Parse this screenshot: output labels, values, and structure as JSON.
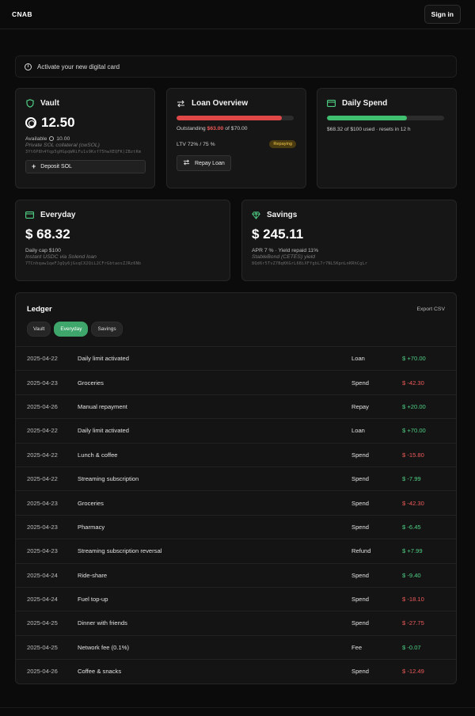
{
  "header": {
    "logo": "CNAB",
    "signin": "Sign in"
  },
  "banner": {
    "icon": "info-icon",
    "text": "Activate your new digital card"
  },
  "vault": {
    "title": "Vault",
    "icon": "shield-icon",
    "balance": "12.50",
    "available_label": "Available",
    "available_value": "10.00",
    "desc": "Private SOL collateral (cwSOL)",
    "address": "3Yt6P8h4Yqp5gHGpqWRiFu1s9Kxf75hwXEQFK)ZBztKm",
    "deposit_label": "Deposit SOL"
  },
  "loan": {
    "title": "Loan Overview",
    "icon": "swap-icon",
    "progress": 0.9,
    "outstanding_prefix": "Outstanding",
    "outstanding_amount": "$63.00",
    "outstanding_suffix": "of $70.00",
    "ltv": "LTV 72% / 75 %",
    "status": "Repaying",
    "repay_label": "Repay Loan"
  },
  "daily": {
    "title": "Daily Spend",
    "icon": "card-icon",
    "progress": 0.6832,
    "text": "$68.32 of $100 used · resets in 12 h"
  },
  "everyday": {
    "title": "Everyday",
    "icon": "card-icon",
    "balance": "$ 68.32",
    "cap": "Daily cap $100",
    "desc": "Instant USDC via Solend loan",
    "address": "7TCnhqaw1qeFJgQy6jGsqCX2QiL2CFrGbtaosZJRz6Nb"
  },
  "savings": {
    "title": "Savings",
    "icon": "gem-icon",
    "balance": "$ 245.11",
    "apr": "APR 7 % · Yield repaid 11%",
    "desc": "StableBond (CETES) yield",
    "address": "8Qd6r5TvZ7BqKKGrL6BiXFfgbL7r7NL5KpnLnKRhCgLr"
  },
  "ledger": {
    "title": "Ledger",
    "export": "Export CSV",
    "tabs": [
      "Vault",
      "Everyday",
      "Savings"
    ],
    "active_tab": "Everyday",
    "rows": [
      {
        "date": "2025-04-22",
        "desc": "Daily limit activated",
        "type": "Loan",
        "amount": "$ +70.00",
        "sign": "pos"
      },
      {
        "date": "2025-04-23",
        "desc": "Groceries",
        "type": "Spend",
        "amount": "$ -42.30",
        "sign": "neg"
      },
      {
        "date": "2025-04-26",
        "desc": "Manual repayment",
        "type": "Repay",
        "amount": "$ +20.00",
        "sign": "pos"
      },
      {
        "date": "2025-04-22",
        "desc": "Daily limit activated",
        "type": "Loan",
        "amount": "$ +70.00",
        "sign": "pos"
      },
      {
        "date": "2025-04-22",
        "desc": "Lunch & coffee",
        "type": "Spend",
        "amount": "$ -15.80",
        "sign": "neg"
      },
      {
        "date": "2025-04-22",
        "desc": "Streaming subscription",
        "type": "Spend",
        "amount": "$ -7.99",
        "sign": "pos"
      },
      {
        "date": "2025-04-23",
        "desc": "Groceries",
        "type": "Spend",
        "amount": "$ -42.30",
        "sign": "neg"
      },
      {
        "date": "2025-04-23",
        "desc": "Pharmacy",
        "type": "Spend",
        "amount": "$ -6.45",
        "sign": "pos"
      },
      {
        "date": "2025-04-23",
        "desc": "Streaming subscription reversal",
        "type": "Refund",
        "amount": "$ +7.99",
        "sign": "pos"
      },
      {
        "date": "2025-04-24",
        "desc": "Ride-share",
        "type": "Spend",
        "amount": "$ -9.40",
        "sign": "pos"
      },
      {
        "date": "2025-04-24",
        "desc": "Fuel top-up",
        "type": "Spend",
        "amount": "$ -18.10",
        "sign": "neg"
      },
      {
        "date": "2025-04-25",
        "desc": "Dinner with friends",
        "type": "Spend",
        "amount": "$ -27.75",
        "sign": "neg"
      },
      {
        "date": "2025-04-25",
        "desc": "Network fee (0.1%)",
        "type": "Fee",
        "amount": "$ -0.07",
        "sign": "pos"
      },
      {
        "date": "2025-04-26",
        "desc": "Coffee & snacks",
        "type": "Spend",
        "amount": "$ -12.49",
        "sign": "neg"
      }
    ]
  }
}
